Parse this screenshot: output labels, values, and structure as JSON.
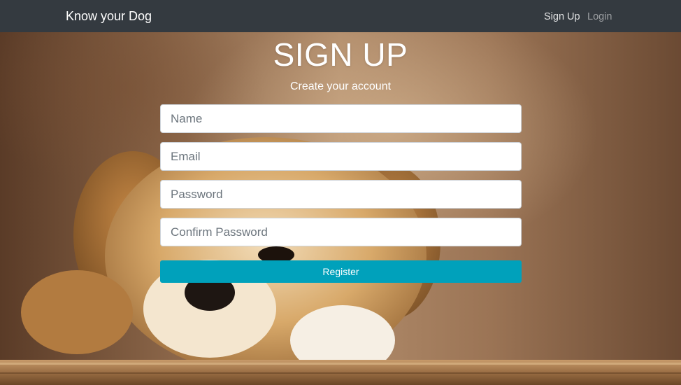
{
  "navbar": {
    "brand": "Know your Dog",
    "links": [
      {
        "label": "Sign Up",
        "active": true
      },
      {
        "label": "Login",
        "active": false
      }
    ]
  },
  "form": {
    "title": "SIGN UP",
    "subtitle": "Create your account",
    "fields": {
      "name_placeholder": "Name",
      "email_placeholder": "Email",
      "password_placeholder": "Password",
      "confirm_placeholder": "Confirm Password"
    },
    "register_label": "Register"
  },
  "colors": {
    "navbar_bg": "#343a40",
    "button_bg": "#00a1bb",
    "text_light": "#ffffff"
  },
  "background": {
    "image_subject": "golden puppy resting its head and paws on a wooden ledge"
  }
}
